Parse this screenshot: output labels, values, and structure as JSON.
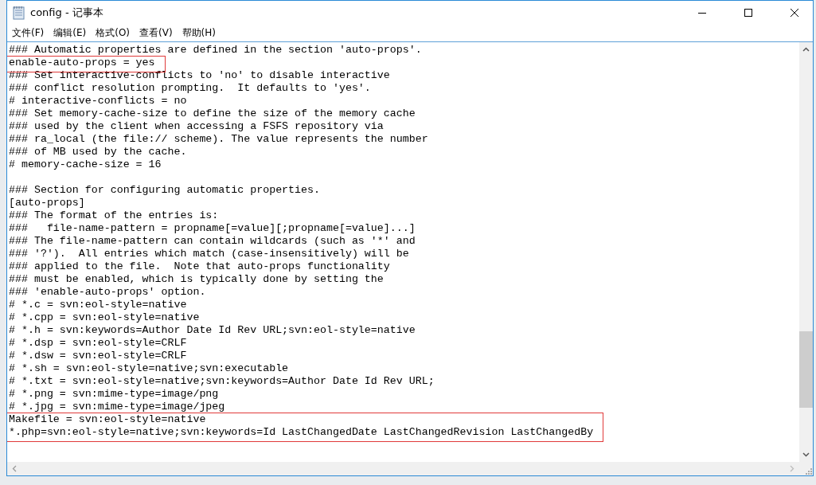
{
  "window": {
    "title": "config - 记事本"
  },
  "menu": [
    "文件(F)",
    "编辑(E)",
    "格式(O)",
    "查看(V)",
    "帮助(H)"
  ],
  "lines": [
    {
      "kind": "text",
      "text": "### Automatic properties are defined in the section 'auto-props'.",
      "highlighted": false
    },
    {
      "kind": "text",
      "text": "enable-auto-props = yes",
      "highlighted": true
    },
    {
      "kind": "text",
      "text": "### Set interactive-conflicts to 'no' to disable interactive",
      "highlighted": false
    },
    {
      "kind": "text",
      "text": "### conflict resolution prompting.  It defaults to 'yes'.",
      "highlighted": false
    },
    {
      "kind": "text",
      "text": "# interactive-conflicts = no",
      "highlighted": false
    },
    {
      "kind": "text",
      "text": "### Set memory-cache-size to define the size of the memory cache",
      "highlighted": false
    },
    {
      "kind": "text",
      "text": "### used by the client when accessing a FSFS repository via",
      "highlighted": false
    },
    {
      "kind": "text",
      "text": "### ra_local (the file:// scheme). The value represents the number",
      "highlighted": false
    },
    {
      "kind": "text",
      "text": "### of MB used by the cache.",
      "highlighted": false
    },
    {
      "kind": "text",
      "text": "# memory-cache-size = 16",
      "highlighted": false
    },
    {
      "kind": "blank"
    },
    {
      "kind": "text",
      "text": "### Section for configuring automatic properties.",
      "highlighted": false
    },
    {
      "kind": "text",
      "text": "[auto-props]",
      "highlighted": false
    },
    {
      "kind": "text",
      "text": "### The format of the entries is:",
      "highlighted": false
    },
    {
      "kind": "text",
      "text": "###   file-name-pattern = propname[=value][;propname[=value]...]",
      "highlighted": false
    },
    {
      "kind": "text",
      "text": "### The file-name-pattern can contain wildcards (such as '*' and",
      "highlighted": false
    },
    {
      "kind": "text",
      "text": "### '?').  All entries which match (case-insensitively) will be",
      "highlighted": false
    },
    {
      "kind": "text",
      "text": "### applied to the file.  Note that auto-props functionality",
      "highlighted": false
    },
    {
      "kind": "text",
      "text": "### must be enabled, which is typically done by setting the",
      "highlighted": false
    },
    {
      "kind": "text",
      "text": "### 'enable-auto-props' option.",
      "highlighted": false
    },
    {
      "kind": "text",
      "text": "# *.c = svn:eol-style=native",
      "highlighted": false
    },
    {
      "kind": "text",
      "text": "# *.cpp = svn:eol-style=native",
      "highlighted": false
    },
    {
      "kind": "text",
      "text": "# *.h = svn:keywords=Author Date Id Rev URL;svn:eol-style=native",
      "highlighted": false
    },
    {
      "kind": "text",
      "text": "# *.dsp = svn:eol-style=CRLF",
      "highlighted": false
    },
    {
      "kind": "text",
      "text": "# *.dsw = svn:eol-style=CRLF",
      "highlighted": false
    },
    {
      "kind": "text",
      "text": "# *.sh = svn:eol-style=native;svn:executable",
      "highlighted": false
    },
    {
      "kind": "text",
      "text": "# *.txt = svn:eol-style=native;svn:keywords=Author Date Id Rev URL;",
      "highlighted": false
    },
    {
      "kind": "text",
      "text": "# *.png = svn:mime-type=image/png",
      "highlighted": false
    },
    {
      "kind": "text",
      "text": "# *.jpg = svn:mime-type=image/jpeg",
      "highlighted": false
    },
    {
      "kind": "text",
      "text": "Makefile = svn:eol-style=native",
      "highlighted": true
    },
    {
      "kind": "text",
      "text": "*.php=svn:eol-style=native;svn:keywords=Id LastChangedDate LastChangedRevision LastChangedBy",
      "highlighted": true
    }
  ]
}
